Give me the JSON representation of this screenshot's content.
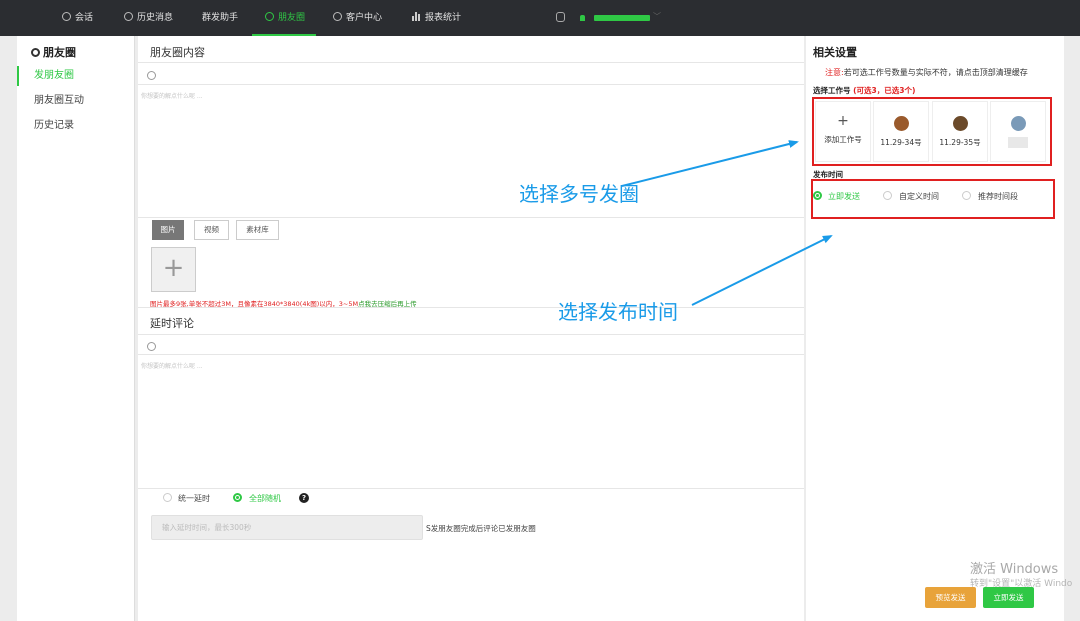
{
  "topnav": {
    "items": [
      "会话",
      "历史消息",
      "群发助手",
      "朋友圈",
      "客户中心",
      "报表统计"
    ],
    "active": "朋友圈"
  },
  "sidebar": {
    "title": "朋友圈",
    "items": [
      "发朋友圈",
      "朋友圈互动",
      "历史记录"
    ],
    "active": "发朋友圈"
  },
  "main": {
    "content_title": "朋友圈内容",
    "content_placeholder": "你想要的解点什么呢 ...",
    "tabs": [
      "图片",
      "视频",
      "素材库"
    ],
    "active_tab": "图片",
    "upload_plus": "+",
    "upload_hint": "图片最多9张,单张不超过3M，且像素在3840*3840(4k图)以内，3~5M点我去压缩后再上传",
    "upload_hint_link": "点我去压缩后再上传",
    "comment_title": "延时评论",
    "comment_placeholder": "你想要的解点什么呢 ...",
    "delay_options": [
      "统一延时",
      "全部随机"
    ],
    "delay_selected": "全部随机",
    "help_icon": "?",
    "delay_input_placeholder": "输入延时时间，最长300秒",
    "delay_note": "S发朋友圈完成后评论已发朋友圈"
  },
  "settings": {
    "title": "相关设置",
    "notice_prefix": "注意:",
    "notice_text": "若可选工作号数量与实际不符，请点击顶部清理缓存",
    "accounts_label": "选择工作号",
    "accounts_count": "(可选3，已选3个)",
    "accounts": [
      {
        "label": "添加工作号",
        "icon": "plus-icon"
      },
      {
        "label": "11.29-34号",
        "icon": "avatar",
        "color": "#9a5a2c"
      },
      {
        "label": "11.29-35号",
        "icon": "avatar",
        "color": "#6b4a2a"
      },
      {
        "label": "",
        "icon": "avatar",
        "color": "#7a9ab8"
      }
    ],
    "time_label": "发布时间",
    "time_options": [
      "立即发送",
      "自定义时间",
      "推荐时间段"
    ],
    "time_selected": "立即发送",
    "preview_button": "预览发送",
    "send_button": "立即发送"
  },
  "annotations": {
    "multi_account": "选择多号发圈",
    "publish_time": "选择发布时间"
  },
  "watermark": {
    "line1": "激活 Windows",
    "line2": "转到\"设置\"以激活 Windo"
  },
  "colors": {
    "accent": "#2fc845",
    "topbar": "#2b2d31",
    "warning": "#e02020",
    "annotation": "#1a9be8",
    "preview_button": "#e8a33a"
  }
}
